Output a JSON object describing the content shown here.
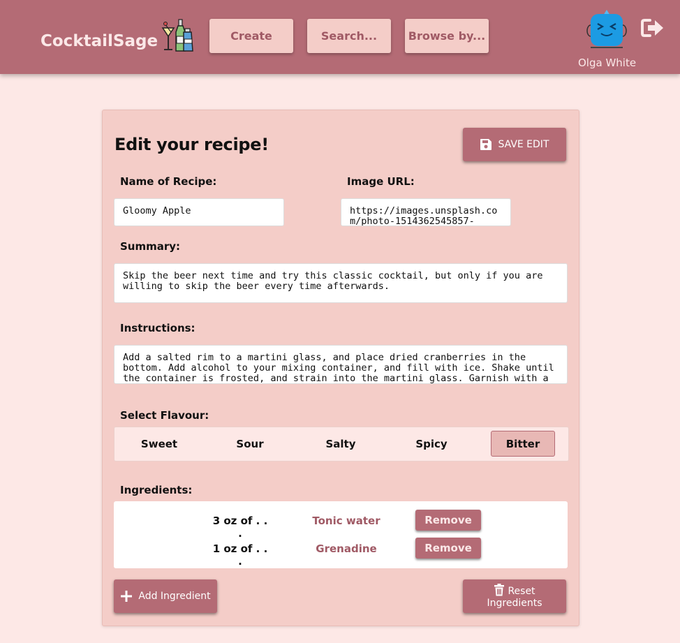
{
  "app": {
    "brand": "CocktailSage",
    "user_name": "Olga White"
  },
  "nav": {
    "create": "Create",
    "search": "Search...",
    "browse": "Browse by..."
  },
  "form": {
    "title": "Edit your recipe!",
    "save_label": "SAVE EDIT",
    "name_label": "Name of Recipe:",
    "name_value": "Gloomy Apple",
    "image_label": "Image URL:",
    "image_value": "https://images.unsplash.com/photo-1514362545857-",
    "summary_label": "Summary:",
    "summary_value": "Skip the beer next time and try this classic cocktail, but only if you are willing to skip the beer every time afterwards.",
    "instructions_label": "Instructions:",
    "instructions_value": "Add a salted rim to a martini glass, and place dried cranberries in the bottom. Add alcohol to your mixing container, and fill with ice. Shake until the container is frosted, and strain into the martini glass. Garnish with a",
    "flavour_label": "Select Flavour:",
    "flavours": [
      "Sweet",
      "Sour",
      "Salty",
      "Spicy",
      "Bitter"
    ],
    "selected_flavour": "Bitter",
    "ingredients_label": "Ingredients:",
    "ingredients": [
      {
        "quantity": "3 oz of . . .",
        "name": "Tonic water",
        "remove_label": "Remove"
      },
      {
        "quantity": "1 oz of . . .",
        "name": "Grenadine",
        "remove_label": "Remove"
      }
    ],
    "add_ingredient_label": "Add Ingredient",
    "reset_label": "Reset Ingredients"
  },
  "icons": {
    "logo": "cocktail-bottles-icon",
    "avatar": "blue-monster-avatar",
    "logout": "sign-out-icon",
    "save": "floppy-disk-icon",
    "add": "plus-icon",
    "reset": "trash-icon"
  },
  "colors": {
    "primary": "#b46b75",
    "background": "#fde8e6",
    "card": "#f4cdc8",
    "accent_text": "#a05a65"
  }
}
